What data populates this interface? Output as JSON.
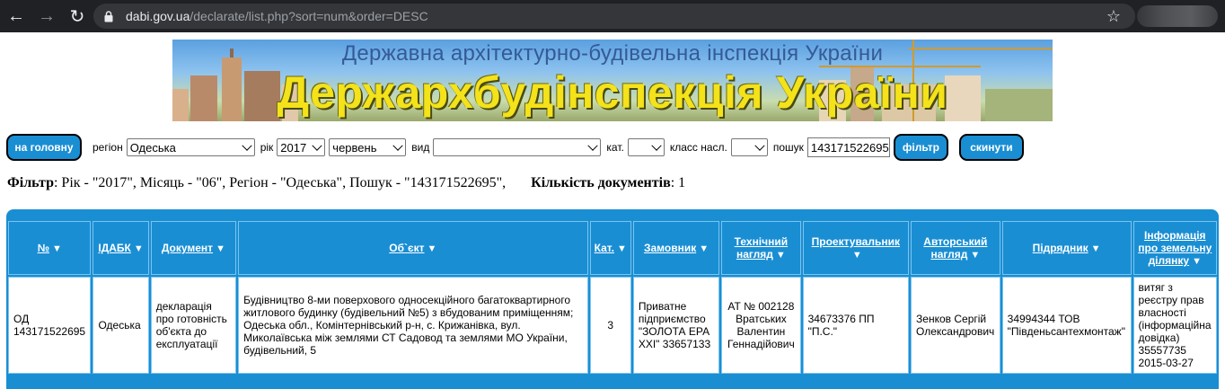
{
  "browser": {
    "url_host": "dabi.gov.ua",
    "url_path": "/declarate/list.php?sort=num&order=DESC"
  },
  "banner": {
    "subtitle": "Державна архітектурно-будівельна інспекція України",
    "title": "Держархбудінспекція України"
  },
  "filters": {
    "home_button": "на головну",
    "region_label": "регіон",
    "region_value": "Одеська",
    "year_label": "рік",
    "year_value": "2017",
    "month_value": "червень",
    "type_label": "вид",
    "type_value": "",
    "category_label": "кат.",
    "category_value": "",
    "class_label": "класс насл.",
    "class_value": "",
    "search_label": "пошук",
    "search_value": "143171522695",
    "filter_button": "фільтр",
    "reset_button": "скинути"
  },
  "summary": {
    "filter_label": "Фільтр",
    "filter_text": ": Рік - \"2017\", Місяць - \"06\", Регіон - \"Одеська\", Пошук - \"143171522695\",",
    "count_label": "Кількість документів",
    "count_value": ": 1"
  },
  "table": {
    "headers": [
      "№",
      "ІДАБК",
      "Документ",
      "Об`єкт",
      "Кат.",
      "Замовник",
      "Технічний нагляд",
      "Проектувальник",
      "Авторський нагляд",
      "Підрядник",
      "Інформація про земельну ділянку"
    ],
    "rows": [
      {
        "num": "ОД 143171522695",
        "idabk": "Одеська",
        "document": "декларація про готовність об'єкта до експлуатації",
        "object": "Будівництво 8-ми поверхового односекційного багатоквартирного житлового будинку (будівельний №5) з вбудованим приміщенням; Одеська обл., Комінтернівський р-н, с. Крижанівка, вул. Миколаївська між землями СТ Садовод та землями МО України, будівельний, 5",
        "category": "3",
        "customer": "Приватне підприємство \"ЗОЛОТА ЕРА XXI\" 33657133",
        "tech_supervision": "АТ № 002128 Вратських Валентин Геннадійович",
        "designer": "34673376 ПП \"П.С.\"",
        "author_supervision": "Зенков Сергій Олександрович",
        "contractor": "34994344 ТОВ \"Південьсантехмонтаж\"",
        "land_info": "витяг з реєстру прав власності (інформаційна довідка) 35557735 2015-03-27"
      }
    ]
  },
  "colors": {
    "primary": "#1a8ed3",
    "cell_border": "#7cc4ee",
    "chrome": "#202124",
    "banner_text": "#f4e21a"
  }
}
